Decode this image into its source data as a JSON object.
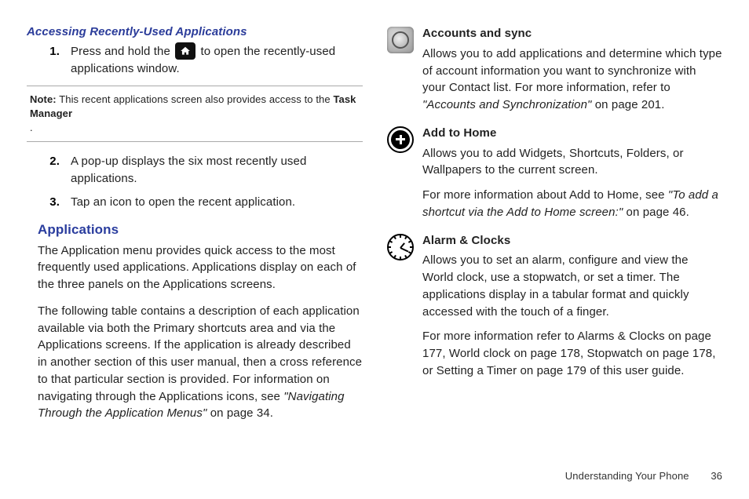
{
  "left": {
    "heading": "Accessing Recently-Used Applications",
    "step1_a": "Press and hold the ",
    "step1_b": " to open the recently-used applications window.",
    "note_label": "Note:",
    "note_text_a": "This recent applications screen also provides access to the ",
    "note_bold": "Task Manager",
    "note_text_b": ".",
    "step2": "A pop-up displays the six most recently used applications.",
    "step3": "Tap an icon to open the recent application.",
    "apps_heading": "Applications",
    "apps_p1": "The Application menu provides quick access to the most frequently used applications. Applications display on each of the three panels on the Applications screens.",
    "apps_p2_a": "The following table contains a description of each application available via both the Primary shortcuts area and via the Applications screens. If the application is already described in another section of this user manual, then a cross reference to that particular section is provided. For information on navigating through the Applications icons, see ",
    "apps_p2_i": "\"Navigating Through the Application Menus\"",
    "apps_p2_b": " on page 34."
  },
  "right": {
    "accounts": {
      "title": "Accounts and sync",
      "p1_a": "Allows you to add applications and determine which type of account information you want to synchronize with your Contact list. For more information, refer to ",
      "p1_i": "\"Accounts and Synchronization\"",
      "p1_b": "  on page 201."
    },
    "addhome": {
      "title": "Add to Home",
      "p1": "Allows you to add Widgets, Shortcuts, Folders, or Wallpapers to the current screen.",
      "p2_a": "For more information about Add to Home, see ",
      "p2_i": "\"To add a shortcut via the Add to Home screen:\"",
      "p2_b": " on page 46."
    },
    "alarm": {
      "title": "Alarm & Clocks",
      "p1": "Allows you to set an alarm, configure and view the World clock, use a stopwatch, or set a timer. The applications display in a tabular format and quickly accessed with the touch of a finger.",
      "p2": "For more information refer to Alarms & Clocks on page 177, World clock on page 178, Stopwatch on page 178, or Setting a Timer on page 179 of this user guide."
    }
  },
  "footer": {
    "section": "Understanding Your Phone",
    "page": "36"
  }
}
